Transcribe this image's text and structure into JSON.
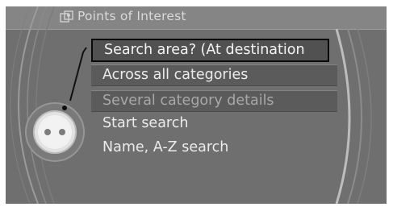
{
  "header": {
    "title": "Points of Interest",
    "icon": "poi-icon"
  },
  "menu": {
    "items": [
      {
        "label": "Search area? (At destination",
        "state": "selected"
      },
      {
        "label": "Across all categories",
        "state": "normal"
      },
      {
        "label": "Several category details",
        "state": "disabled"
      },
      {
        "label": "Start search",
        "state": "normal"
      },
      {
        "label": "Name, A-Z search",
        "state": "normal"
      }
    ]
  },
  "controller": {
    "icon": "idrive-controller-icon"
  },
  "colors": {
    "screen_bg": "#6f6f6f",
    "header_bg": "#858585",
    "row_bg": "#5b5b5b",
    "selection_border": "#0a0a0a",
    "text": "#ececec",
    "disabled_text": "#a8a8a8"
  }
}
